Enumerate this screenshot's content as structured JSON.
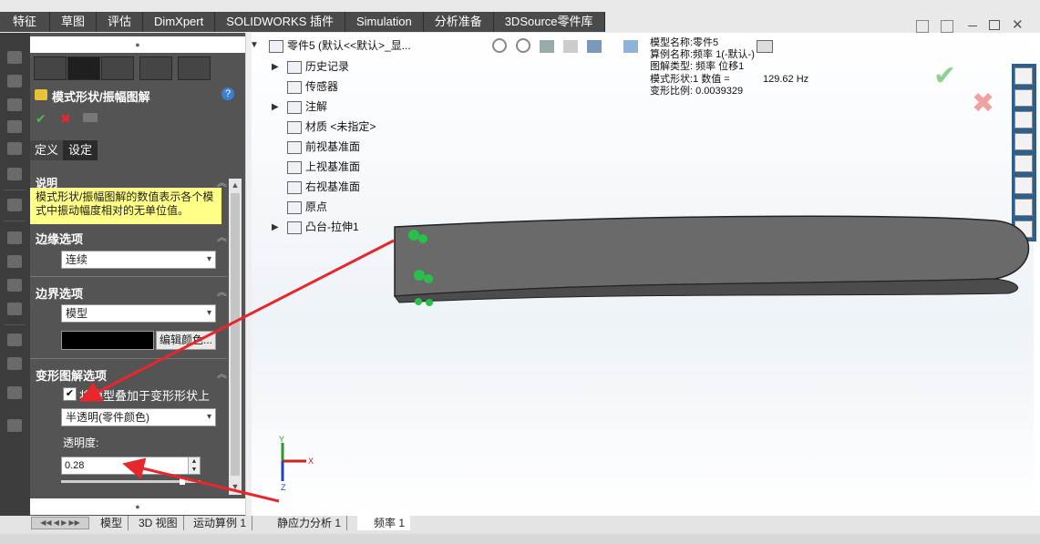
{
  "top_tabs": [
    "特征",
    "草图",
    "评估",
    "DimXpert",
    "SOLIDWORKS 插件",
    "Simulation",
    "分析准备",
    "3DSource零件库"
  ],
  "panel": {
    "title": "模式形状/振幅图解",
    "subtabs": [
      "定义",
      "设定"
    ],
    "note_header": "说明",
    "note_text": "模式形状/振幅图解的数值表示各个模式中振动幅度相对的无单位值。",
    "edge_header": "边缘选项",
    "edge_value": "连续",
    "boundary_header": "边界选项",
    "boundary_value": "模型",
    "edit_color_label": "编辑颜色...",
    "deform_header": "变形图解选项",
    "overlay_label": "将模型叠加于变形形状上",
    "overlay_checked": true,
    "mode_value": "半透明(零件颜色)",
    "transparency_label": "透明度:",
    "transparency_value": "0.28"
  },
  "tree": {
    "root": "零件5 (默认<<默认>_显...",
    "items": [
      "历史记录",
      "传感器",
      "注解",
      "材质 <未指定>",
      "前视基准面",
      "上视基准面",
      "右视基准面",
      "原点",
      "凸台-拉伸1"
    ]
  },
  "info": {
    "model_name": "模型名称:零件5",
    "study_name": "算例名称:频率 1(-默认-)",
    "plot_type": "图解类型: 频率 位移1",
    "mode_shape": "模式形状:1  数值 =",
    "freq_value": "129.62 Hz",
    "scale": "变形比例: 0.0039329"
  },
  "bottom_tabs": [
    "模型",
    "3D 视图",
    "运动算例 1",
    "静应力分析 1",
    "频率 1"
  ],
  "triad_axes": {
    "x": "X",
    "y": "Y",
    "z": "Z"
  },
  "colors": {
    "accent_red": "#e8262b",
    "panel_bg": "#545454",
    "note_bg": "#ffff88",
    "ok_green": "#37a53a"
  }
}
